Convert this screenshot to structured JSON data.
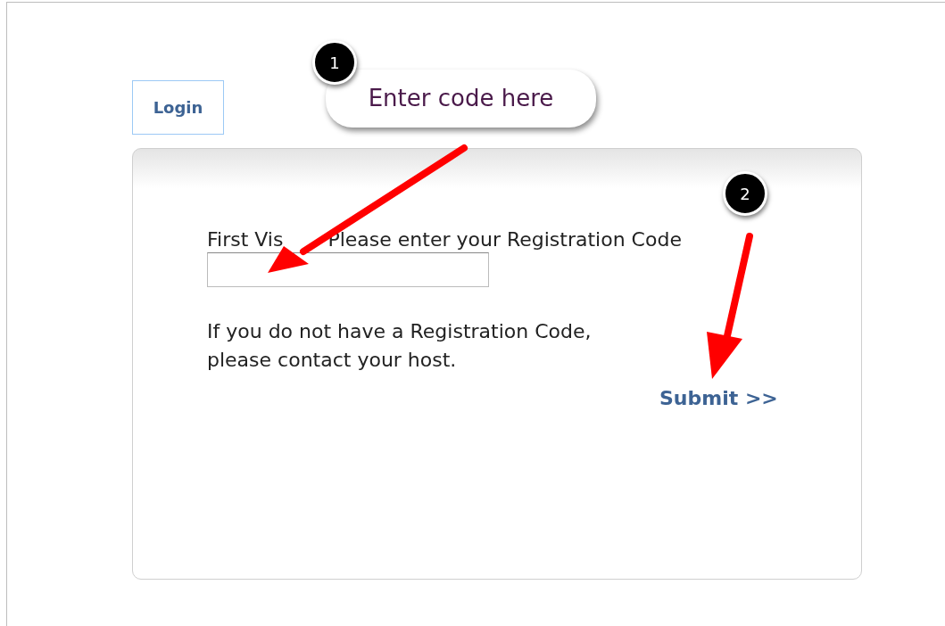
{
  "login_tab": {
    "label": "Login"
  },
  "form": {
    "code_label_parts": [
      "First Vis",
      "Please enter your Registration Code"
    ],
    "help_text": "If you do not have a Registration Code, please contact your host.",
    "submit": "Submit >>"
  },
  "annotations": [
    {
      "number": "1",
      "text": "Enter code here"
    },
    {
      "number": "2"
    }
  ]
}
